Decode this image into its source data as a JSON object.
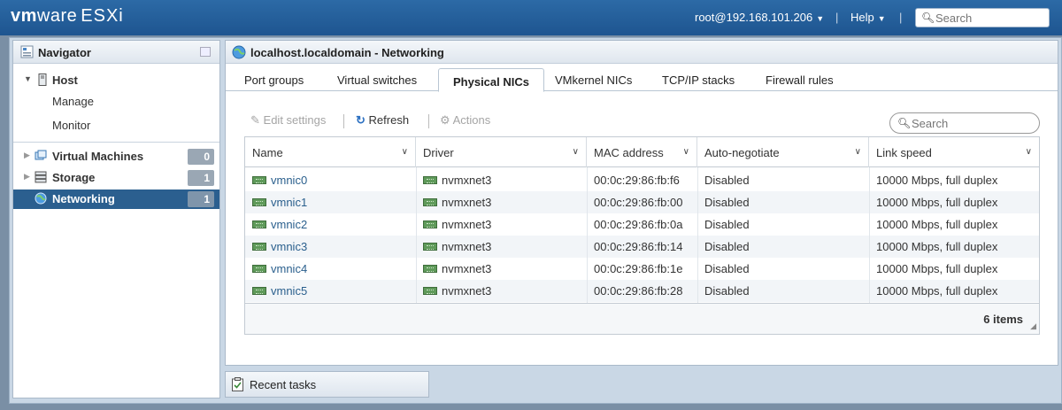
{
  "topbar": {
    "logo_vm": "vm",
    "logo_ware": "ware",
    "logo_product": "ESXi",
    "user": "root@192.168.101.206",
    "help": "Help",
    "search_placeholder": "Search",
    "bg_color": "#1e5590"
  },
  "navigator": {
    "title": "Navigator",
    "host": "Host",
    "manage": "Manage",
    "monitor": "Monitor",
    "items": [
      {
        "label": "Virtual Machines",
        "badge": "0"
      },
      {
        "label": "Storage",
        "badge": "1"
      },
      {
        "label": "Networking",
        "badge": "1"
      }
    ],
    "active_color": "#2b5f8f"
  },
  "panel": {
    "title": "localhost.localdomain - Networking",
    "tabs": [
      "Port groups",
      "Virtual switches",
      "Physical NICs",
      "VMkernel NICs",
      "TCP/IP stacks",
      "Firewall rules"
    ],
    "active_tab": "Physical NICs",
    "toolbar": {
      "edit": "Edit settings",
      "refresh": "Refresh",
      "actions": "Actions"
    },
    "search_placeholder": "Search"
  },
  "grid": {
    "columns": [
      "Name",
      "Driver",
      "MAC address",
      "Auto-negotiate",
      "Link speed"
    ],
    "rows": [
      [
        "vmnic0",
        "nvmxnet3",
        "00:0c:29:86:fb:f6",
        "Disabled",
        "10000 Mbps, full duplex"
      ],
      [
        "vmnic1",
        "nvmxnet3",
        "00:0c:29:86:fb:00",
        "Disabled",
        "10000 Mbps, full duplex"
      ],
      [
        "vmnic2",
        "nvmxnet3",
        "00:0c:29:86:fb:0a",
        "Disabled",
        "10000 Mbps, full duplex"
      ],
      [
        "vmnic3",
        "nvmxnet3",
        "00:0c:29:86:fb:14",
        "Disabled",
        "10000 Mbps, full duplex"
      ],
      [
        "vmnic4",
        "nvmxnet3",
        "00:0c:29:86:fb:1e",
        "Disabled",
        "10000 Mbps, full duplex"
      ],
      [
        "vmnic5",
        "nvmxnet3",
        "00:0c:29:86:fb:28",
        "Disabled",
        "10000 Mbps, full duplex"
      ]
    ],
    "count": "6 items"
  },
  "recent_tasks": "Recent tasks"
}
